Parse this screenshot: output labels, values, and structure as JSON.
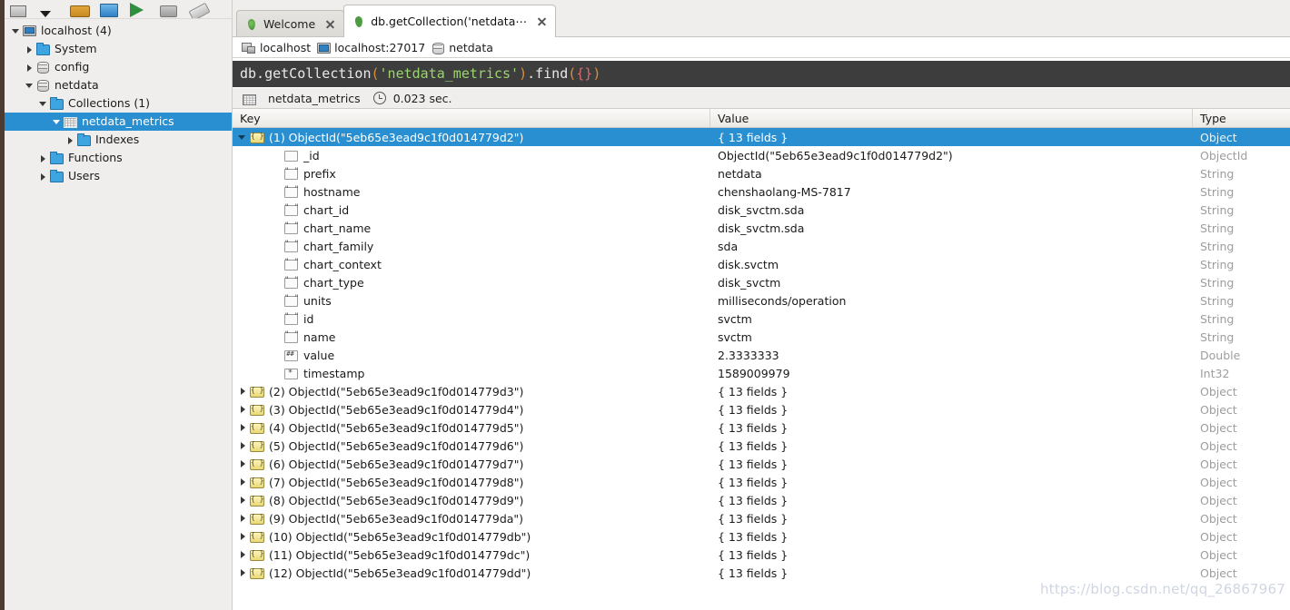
{
  "toolbar": {
    "icons": [
      "connect-icon",
      "dropdown-arrow-icon",
      "open-folder-icon",
      "save-icon",
      "execute-icon",
      "stop-icon",
      "attach-icon"
    ]
  },
  "sidebar": {
    "tree": [
      {
        "label": "localhost (4)",
        "icon": "server-icon",
        "arrow": "down",
        "depth": 0,
        "selected": false
      },
      {
        "label": "System",
        "icon": "folder-icon",
        "arrow": "right",
        "depth": 1,
        "selected": false
      },
      {
        "label": "config",
        "icon": "database-icon",
        "arrow": "right",
        "depth": 1,
        "selected": false
      },
      {
        "label": "netdata",
        "icon": "database-icon",
        "arrow": "down",
        "depth": 1,
        "selected": false
      },
      {
        "label": "Collections (1)",
        "icon": "folder-icon",
        "arrow": "down",
        "depth": 2,
        "selected": false
      },
      {
        "label": "netdata_metrics",
        "icon": "collection-icon",
        "arrow": "down",
        "depth": 3,
        "selected": true
      },
      {
        "label": "Indexes",
        "icon": "folder-icon",
        "arrow": "right",
        "depth": 4,
        "selected": false
      },
      {
        "label": "Functions",
        "icon": "folder-icon",
        "arrow": "right",
        "depth": 2,
        "selected": false
      },
      {
        "label": "Users",
        "icon": "folder-icon",
        "arrow": "right",
        "depth": 2,
        "selected": false
      }
    ]
  },
  "tabs": [
    {
      "label": "Welcome",
      "icon": "mongodb-leaf-icon",
      "active": false,
      "close": "close-icon"
    },
    {
      "label": "db.getCollection('netdata⋯",
      "icon": "mongodb-leaf-icon",
      "active": true,
      "close": "close-icon"
    }
  ],
  "breadcrumb": [
    {
      "label": "localhost",
      "icon": "connection-icon"
    },
    {
      "label": "localhost:27017",
      "icon": "monitor-icon"
    },
    {
      "label": "netdata",
      "icon": "database-icon"
    }
  ],
  "editor": {
    "full_query": "db.getCollection('netdata_metrics').find({})",
    "tokens": [
      {
        "text": "db.getCollection",
        "type": "plain"
      },
      {
        "text": "(",
        "type": "paren"
      },
      {
        "text": "'netdata_metrics'",
        "type": "string"
      },
      {
        "text": ")",
        "type": "paren"
      },
      {
        "text": ".find",
        "type": "plain"
      },
      {
        "text": "(",
        "type": "paren"
      },
      {
        "text": "{}",
        "type": "brace"
      },
      {
        "text": ")",
        "type": "paren"
      }
    ]
  },
  "result_bar": {
    "collection": "netdata_metrics",
    "clock_icon": "clock-icon",
    "grid_icon": "collection-icon",
    "elapsed": "0.023 sec."
  },
  "grid": {
    "columns": [
      "Key",
      "Value",
      "Type"
    ],
    "rows": [
      {
        "key": "(1) ObjectId(\"5eb65e3ead9c1f0d014779d2\")",
        "value": "{ 13 fields }",
        "type": "Object",
        "icon": "document-icon",
        "arrow": "down",
        "depth": 0,
        "selected": true
      },
      {
        "key": "_id",
        "value": "ObjectId(\"5eb65e3ead9c1f0d014779d2\")",
        "type": "ObjectId",
        "icon": "blank-field-icon",
        "arrow": "none",
        "depth": 1,
        "selected": false
      },
      {
        "key": "prefix",
        "value": "netdata",
        "type": "String",
        "icon": "string-field-icon",
        "arrow": "none",
        "depth": 1,
        "selected": false
      },
      {
        "key": "hostname",
        "value": "chenshaolang-MS-7817",
        "type": "String",
        "icon": "string-field-icon",
        "arrow": "none",
        "depth": 1,
        "selected": false
      },
      {
        "key": "chart_id",
        "value": "disk_svctm.sda",
        "type": "String",
        "icon": "string-field-icon",
        "arrow": "none",
        "depth": 1,
        "selected": false
      },
      {
        "key": "chart_name",
        "value": "disk_svctm.sda",
        "type": "String",
        "icon": "string-field-icon",
        "arrow": "none",
        "depth": 1,
        "selected": false
      },
      {
        "key": "chart_family",
        "value": "sda",
        "type": "String",
        "icon": "string-field-icon",
        "arrow": "none",
        "depth": 1,
        "selected": false
      },
      {
        "key": "chart_context",
        "value": "disk.svctm",
        "type": "String",
        "icon": "string-field-icon",
        "arrow": "none",
        "depth": 1,
        "selected": false
      },
      {
        "key": "chart_type",
        "value": "disk_svctm",
        "type": "String",
        "icon": "string-field-icon",
        "arrow": "none",
        "depth": 1,
        "selected": false
      },
      {
        "key": "units",
        "value": "milliseconds/operation",
        "type": "String",
        "icon": "string-field-icon",
        "arrow": "none",
        "depth": 1,
        "selected": false
      },
      {
        "key": "id",
        "value": "svctm",
        "type": "String",
        "icon": "string-field-icon",
        "arrow": "none",
        "depth": 1,
        "selected": false
      },
      {
        "key": "name",
        "value": "svctm",
        "type": "String",
        "icon": "string-field-icon",
        "arrow": "none",
        "depth": 1,
        "selected": false
      },
      {
        "key": "value",
        "value": "2.3333333",
        "type": "Double",
        "icon": "double-field-icon",
        "arrow": "none",
        "depth": 1,
        "selected": false
      },
      {
        "key": "timestamp",
        "value": "1589009979",
        "type": "Int32",
        "icon": "int-field-icon",
        "arrow": "none",
        "depth": 1,
        "selected": false
      },
      {
        "key": "(2) ObjectId(\"5eb65e3ead9c1f0d014779d3\")",
        "value": "{ 13 fields }",
        "type": "Object",
        "icon": "document-icon",
        "arrow": "right",
        "depth": 0,
        "selected": false
      },
      {
        "key": "(3) ObjectId(\"5eb65e3ead9c1f0d014779d4\")",
        "value": "{ 13 fields }",
        "type": "Object",
        "icon": "document-icon",
        "arrow": "right",
        "depth": 0,
        "selected": false
      },
      {
        "key": "(4) ObjectId(\"5eb65e3ead9c1f0d014779d5\")",
        "value": "{ 13 fields }",
        "type": "Object",
        "icon": "document-icon",
        "arrow": "right",
        "depth": 0,
        "selected": false
      },
      {
        "key": "(5) ObjectId(\"5eb65e3ead9c1f0d014779d6\")",
        "value": "{ 13 fields }",
        "type": "Object",
        "icon": "document-icon",
        "arrow": "right",
        "depth": 0,
        "selected": false
      },
      {
        "key": "(6) ObjectId(\"5eb65e3ead9c1f0d014779d7\")",
        "value": "{ 13 fields }",
        "type": "Object",
        "icon": "document-icon",
        "arrow": "right",
        "depth": 0,
        "selected": false
      },
      {
        "key": "(7) ObjectId(\"5eb65e3ead9c1f0d014779d8\")",
        "value": "{ 13 fields }",
        "type": "Object",
        "icon": "document-icon",
        "arrow": "right",
        "depth": 0,
        "selected": false
      },
      {
        "key": "(8) ObjectId(\"5eb65e3ead9c1f0d014779d9\")",
        "value": "{ 13 fields }",
        "type": "Object",
        "icon": "document-icon",
        "arrow": "right",
        "depth": 0,
        "selected": false
      },
      {
        "key": "(9) ObjectId(\"5eb65e3ead9c1f0d014779da\")",
        "value": "{ 13 fields }",
        "type": "Object",
        "icon": "document-icon",
        "arrow": "right",
        "depth": 0,
        "selected": false
      },
      {
        "key": "(10) ObjectId(\"5eb65e3ead9c1f0d014779db\")",
        "value": "{ 13 fields }",
        "type": "Object",
        "icon": "document-icon",
        "arrow": "right",
        "depth": 0,
        "selected": false
      },
      {
        "key": "(11) ObjectId(\"5eb65e3ead9c1f0d014779dc\")",
        "value": "{ 13 fields }",
        "type": "Object",
        "icon": "document-icon",
        "arrow": "right",
        "depth": 0,
        "selected": false
      },
      {
        "key": "(12) ObjectId(\"5eb65e3ead9c1f0d014779dd\")",
        "value": "{ 13 fields }",
        "type": "Object",
        "icon": "document-icon",
        "arrow": "right",
        "depth": 0,
        "selected": false
      }
    ]
  },
  "watermark": "https://blog.csdn.net/qq_26867967",
  "colors": {
    "selection_blue": "#2a8fd0",
    "chrome_gray": "#efeeec",
    "editor_bg": "#3d3d3d",
    "string_token": "#9ad66b",
    "paren_token": "#d88f3c",
    "brace_token": "#d96a6a",
    "type_text": "#9d9d9d",
    "edge_strip": "#4a3b33"
  }
}
